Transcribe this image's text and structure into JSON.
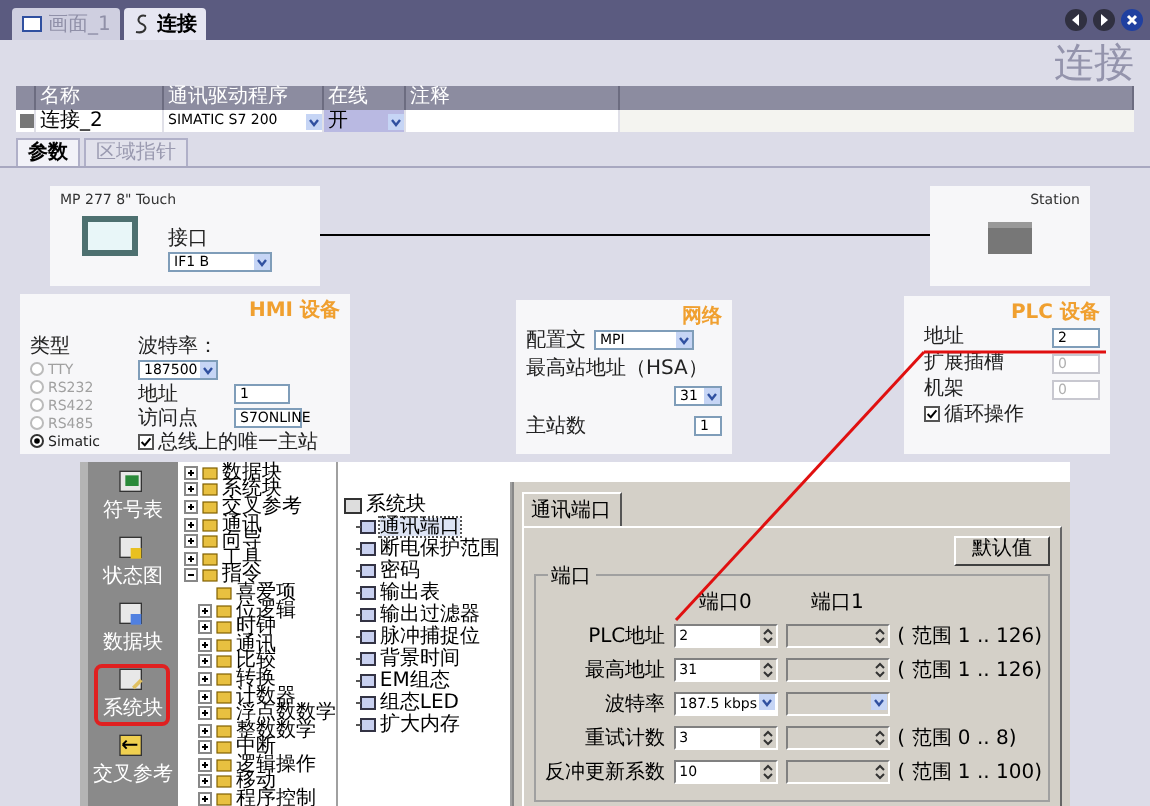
{
  "document_tabs": [
    {
      "label": "画面_1",
      "kind": "screen",
      "selected": false
    },
    {
      "label": "连接",
      "kind": "script",
      "selected": true
    }
  ],
  "editor_title": "连接",
  "table": {
    "columns": [
      "名称",
      "通讯驱动程序",
      "在线",
      "注释"
    ],
    "rows": [
      {
        "name": "连接_2",
        "driver": "SIMATIC S7 200",
        "online": "开"
      }
    ]
  },
  "sub_tabs": [
    {
      "label": "参数",
      "selected": true
    },
    {
      "label": "区域指针",
      "selected": false
    }
  ],
  "hmi_station": {
    "device": "MP 277 8\" Touch",
    "interface_label": "接口",
    "interface": "IF1 B"
  },
  "plc_station": {
    "label": "Station"
  },
  "hmi_device": {
    "title": "HMI 设备",
    "type_label": "类型",
    "types": [
      {
        "label": "TTY",
        "selected": false,
        "disabled": true
      },
      {
        "label": "RS232",
        "selected": false,
        "disabled": true
      },
      {
        "label": "RS422",
        "selected": false,
        "disabled": true
      },
      {
        "label": "RS485",
        "selected": false,
        "disabled": true
      },
      {
        "label": "Simatic",
        "selected": true,
        "disabled": false
      }
    ],
    "baud_label": "波特率：",
    "baud": "187500",
    "address_label": "地址",
    "address": "1",
    "access_label": "访问点",
    "access": "S7ONLINE",
    "single_master": {
      "label": "总线上的唯一主站",
      "checked": true
    }
  },
  "network": {
    "title": "网络",
    "profile_label": "配置文",
    "profile": "MPI",
    "hsa_label": "最高站地址（HSA）",
    "hsa": "31",
    "masters_label": "主站数",
    "masters": "1"
  },
  "plc_device": {
    "title": "PLC 设备",
    "fields": [
      {
        "label": "地址",
        "value": "2",
        "disabled": false
      },
      {
        "label": "扩展插槽",
        "value": "0",
        "disabled": true
      },
      {
        "label": "机架",
        "value": "0",
        "disabled": true
      }
    ],
    "cyclic": {
      "label": "循环操作",
      "checked": true
    }
  },
  "microwin": {
    "nav": [
      {
        "label": "符号表",
        "kind": "table",
        "selected": false
      },
      {
        "label": "状态图",
        "kind": "chart",
        "selected": false
      },
      {
        "label": "数据块",
        "kind": "data",
        "selected": false
      },
      {
        "label": "系统块",
        "kind": "system",
        "selected": true
      },
      {
        "label": "交叉参考",
        "kind": "cross",
        "selected": false
      }
    ],
    "project_tree": [
      {
        "label": "数据块",
        "expanded": false
      },
      {
        "label": "系统块",
        "expanded": false
      },
      {
        "label": "交叉参考",
        "expanded": false
      },
      {
        "label": "通讯",
        "expanded": false
      },
      {
        "label": "向导",
        "expanded": false
      },
      {
        "label": "工具",
        "expanded": false
      },
      {
        "label": "指令",
        "expanded": true,
        "children": [
          {
            "label": "喜爱项"
          },
          {
            "label": "位逻辑",
            "expanded": false
          },
          {
            "label": "时钟",
            "expanded": false
          },
          {
            "label": "通讯",
            "expanded": false
          },
          {
            "label": "比较",
            "expanded": false
          },
          {
            "label": "转换",
            "expanded": false
          },
          {
            "label": "计数器",
            "expanded": false
          },
          {
            "label": "浮点数数学",
            "expanded": false
          },
          {
            "label": "整数数学",
            "expanded": false
          },
          {
            "label": "中断",
            "expanded": false
          },
          {
            "label": "逻辑操作",
            "expanded": false
          },
          {
            "label": "移动",
            "expanded": false
          },
          {
            "label": "程序控制",
            "expanded": false
          }
        ]
      }
    ],
    "system_block": {
      "label": "系统块",
      "items": [
        {
          "label": "通讯端口",
          "selected": true
        },
        {
          "label": "断电保护范围",
          "selected": false
        },
        {
          "label": "密码",
          "selected": false
        },
        {
          "label": "输出表",
          "selected": false
        },
        {
          "label": "输出过滤器",
          "selected": false
        },
        {
          "label": "脉冲捕捉位",
          "selected": false
        },
        {
          "label": "背景时间",
          "selected": false
        },
        {
          "label": "EM组态",
          "selected": false
        },
        {
          "label": "组态LED",
          "selected": false
        },
        {
          "label": "扩大内存",
          "selected": false
        }
      ]
    },
    "dialog": {
      "tab": "通讯端口",
      "default_button": "默认值",
      "group": "端口",
      "columns": [
        "端口0",
        "端口1"
      ],
      "rows": [
        {
          "label": "PLC地址",
          "kind": "spin",
          "value": "2",
          "range": "( 范围 1 .. 126)"
        },
        {
          "label": "最高地址",
          "kind": "spin",
          "value": "31",
          "range": "( 范围 1 .. 126)"
        },
        {
          "label": "波特率",
          "kind": "select",
          "value": "187.5 kbps"
        },
        {
          "label": "重试计数",
          "kind": "spin",
          "value": "3",
          "range": "( 范围 0 .. 8)"
        },
        {
          "label": "反冲更新系数",
          "kind": "spin",
          "value": "10",
          "range": "( 范围 1 .. 100)"
        }
      ]
    }
  }
}
